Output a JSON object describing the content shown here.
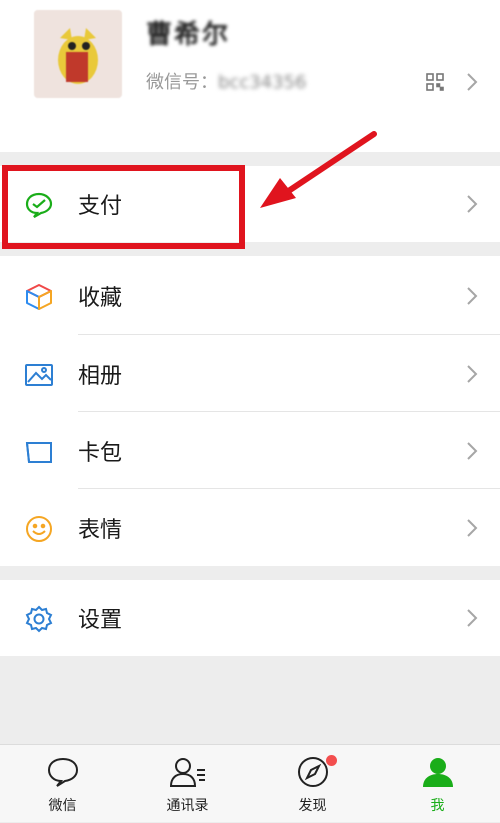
{
  "profile": {
    "name": "曹希尔",
    "wechat_id_label": "微信号：",
    "wechat_id_value": "bcc34356"
  },
  "menu": {
    "pay": "支付",
    "favorites": "收藏",
    "album": "相册",
    "cards": "卡包",
    "stickers": "表情",
    "settings": "设置"
  },
  "tabbar": {
    "chats": "微信",
    "contacts": "通讯录",
    "discover": "发现",
    "me": "我"
  },
  "colors": {
    "accent": "#1aad19",
    "highlight": "#e0141e",
    "badge": "#f34e4e"
  }
}
